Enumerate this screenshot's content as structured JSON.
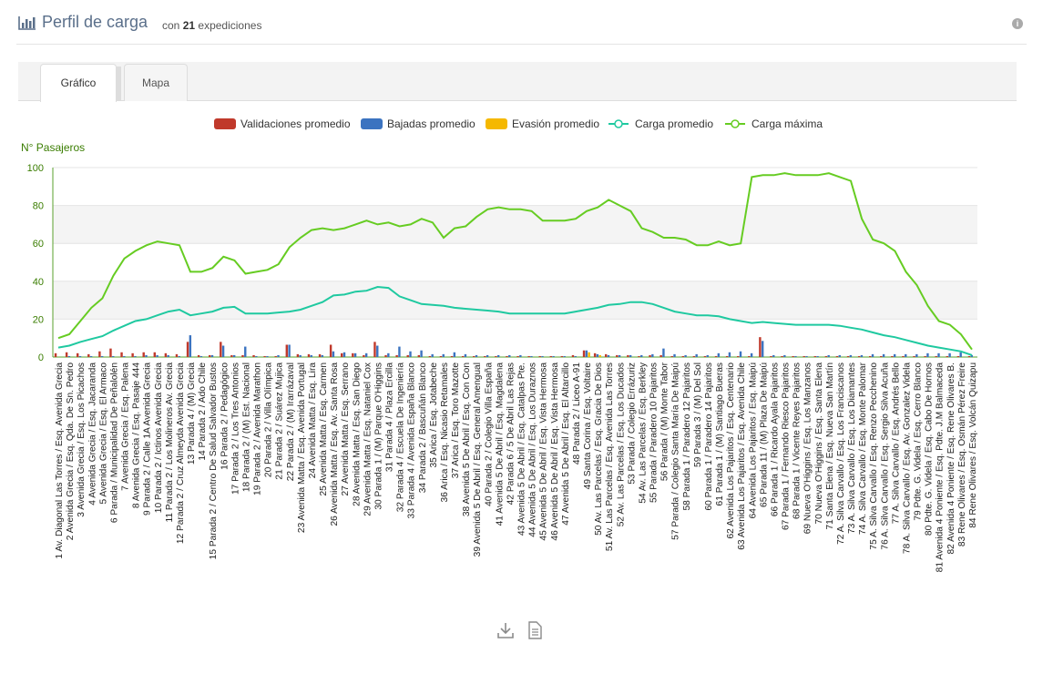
{
  "header": {
    "title": "Perfil de carga",
    "sub_prefix": "con",
    "count": "21",
    "sub_suffix": "expediciones"
  },
  "tabs": [
    {
      "label": "Gráfico"
    },
    {
      "label": "Mapa"
    }
  ],
  "colors": {
    "validaciones": "#c0392b",
    "bajadas": "#3b73c0",
    "evasion": "#f5b800",
    "carga_prom": "#1fc9a0",
    "carga_max": "#66cc22"
  },
  "chart_data": {
    "type": "bar",
    "ylabel": "N° Pasajeros",
    "ylim": [
      0,
      100
    ],
    "yticks": [
      0,
      20,
      40,
      60,
      80,
      100
    ],
    "legend": [
      "Validaciones promedio",
      "Bajadas promedio",
      "Evasión promedio",
      "Carga promedio",
      "Carga máxima"
    ],
    "legend_position": "top-center",
    "categories": [
      "1 Av. Diagonal Las Torres / Esq. Avenida Grecia",
      "2 Avenida Grecia / Esq. Qda. De Sn. Pedro",
      "3 Avenida Grecia / Esq. Los Picachos",
      "4 Avenida Grecia / Esq. Jacaranda",
      "5 Avenida Grecia / Esq. El Armaco",
      "6 Parada / Municipalidad De Peñalolén",
      "7 Avenida Grecia / Esq. Palena",
      "8 Avenida Grecia / Esq. Pasaje 444",
      "9 Parada 2 / Calle 1A Avenida Grecia",
      "10 Parada 2 / Ictinos Avenida Grecia",
      "11 Parada 2 / Los Molineros Av. Grecia",
      "12 Parada 2 / Cruz Almeyda Avenida Grecia",
      "13 Parada 4 / (M) Grecia",
      "14 Parada 2 / Ado Chile",
      "15 Parada 2 / Centro De Salud Salvador Bustos",
      "16 Parada 2 / Pedagógico",
      "17 Parada 2 / Los Tres Antonios",
      "18 Parada 2 / (M) Est. Nacional",
      "19 Parada 2 / Avenida Marathon",
      "20 Parada 2 / Villa Olímpica",
      "21 Parada 2 / Suárez Mujica",
      "22 Parada 2 / (M) Irarrázaval",
      "23 Avenida Matta / Esq. Avenida Portugal",
      "24 Avenida Matta / Esq. Lira",
      "25 Avenida Matta / Esq. Carmen",
      "26 Avenida Matta / Esq. Av. Santa Rosa",
      "27 Avenida Matta / Esq. Serrano",
      "28 Avenida Matta / Esq. San Diego",
      "29 Avenida Matta / Esq. Nataniel Cox",
      "30 Parada 1 / (M) Parque O'Higgins",
      "31 Parada 4 / Plaza Ercilla",
      "32 Parada 4 / Escuela De Ingeniería",
      "33 Parada 4 / Avenida España Blanco",
      "34 Parada 2 / Bascuñán Blanco",
      "35 Arica / Esq. Jotabeche",
      "36 Arica / Esq. Nicasio Retamales",
      "37 Arica / Esq. Toro Mazotte",
      "38 Avenida 5 De Abril / Esq. Con Con",
      "39 Avenida 5 De Abril / Esq. General Amengual",
      "40 Parada 2 / Colegio Villa España",
      "41 Avenida 5 De Abril / Esq. Magdalena",
      "42 Parada 6 / 5 De Abril Las Rejas",
      "43 Avenida 5 De Abril / Esq. Catalpas Pte.",
      "44 Avenida 5 De Abril / Esq. Los Duraznos",
      "45 Avenida 5 De Abril / Esq. Vista Hermosa",
      "46 Avenida 5 De Abril / Esq. Vista Hermosa",
      "47 Avenida 5 De Abril / Esq. El Altarcillo",
      "48 Parada 2 / Liceo A-91",
      "49 Santa Corina / Esq. Voltaire",
      "50 Av. Las Parcelas / Esq. Gracia De Dios",
      "51 Av. Las Parcelas / Esq. Avenida Las Torres",
      "52 Av. Las Parcelas / Esq. Los Ducados",
      "53 Parada / Colegio Errázuriz",
      "54 Av. Las Parcelas / Esq. Berkley",
      "55 Parada / Paradero 10 Pajaritos",
      "56 Parada / (M) Monte Tabor",
      "57 Parada / Colegio Santa María De Maipú",
      "58 Parada 1 / Paradero 12 Pajaritos",
      "59 Parada 3 / (M) Del Sol",
      "60 Parada 1 / Paradero 14 Pajaritos",
      "61 Parada 1 / (M) Santiago Bueras",
      "62 Avenida Los Pajaritos / Esq. Centenario",
      "63 Avenida Los Pajaritos / Esq. Avenida Chile",
      "64 Avenida Los Pajaritos / Esq. Maipú",
      "65 Parada 11 / (M) Plaza De Maipú",
      "66 Parada 1 / Ricardo Ayala Pajaritos",
      "67 Parada 1 / Fernando Riesco Pajaritos",
      "68 Parada 1 / Vicente Reyes Pajaritos",
      "69 Nueva O'Higgins / Esq. Los Manzanos",
      "70 Nueva O'Higgins / Esq. Santa Elena",
      "71 Santa Elena / Esq. Nueva San Martín",
      "72 A. Silva Carvallo / Esq. Los Franciscanos",
      "73 A. Silva Carvallo / Esq. Los Diamantes",
      "74 A. Silva Carvallo / Esq. Monte Palomar",
      "75 A. Silva Carvallo / Esq. Renzo Pecchenino",
      "76 A. Silva Carvallo / Esq. Sergio Silva Acuña",
      "77 A. Silva Carvallo / Esq. Andrés Bello",
      "78 A. Silva Carvallo / Esq. Av. Gonzalez Videla",
      "79 Pdte. G. Videla / Esq. Cerro Blanco",
      "80 Pdte. G. Videla / Esq. Cabo De Hornos",
      "81 Avenida 4 Poniente / Esq. Pdte. J.M Balmaceda",
      "82 Avenida 4 Poniente / Esq. Rene Olivares B.",
      "83 Rene Olivares / Esq. Osmán Pérez Freire",
      "84 Rene Olivares / Esq. Volcán Quizapu"
    ],
    "series": [
      {
        "name": "Validaciones promedio",
        "type": "bar",
        "values": [
          2,
          2.5,
          2,
          1.5,
          3,
          4.5,
          2.5,
          2,
          2.5,
          2.5,
          2,
          1.5,
          8,
          1,
          1,
          8,
          1,
          1,
          1,
          0.5,
          0.5,
          6.5,
          1.5,
          1.5,
          1.5,
          6.5,
          2,
          2,
          1,
          8,
          1,
          1,
          1,
          1,
          0.5,
          0.5,
          0.5,
          0.5,
          0.5,
          0.5,
          0.5,
          0.5,
          0.5,
          0.5,
          0.5,
          0.5,
          0.5,
          1,
          3.5,
          2,
          1.5,
          1,
          1,
          0.5,
          1,
          1,
          0.5,
          0.5,
          0.5,
          0.5,
          0.5,
          0.5,
          0.5,
          0.5,
          10.5,
          0.5,
          0.5,
          0.5,
          0.5,
          0.5,
          0.5,
          0.5,
          0.5,
          0.5,
          0.5,
          0.5,
          0.5,
          0.5,
          0.5,
          0.5,
          0.5,
          0.5,
          0.5,
          0.5
        ]
      },
      {
        "name": "Bajadas promedio",
        "type": "bar",
        "values": [
          0,
          0.5,
          0.5,
          0.5,
          0.5,
          0.5,
          0.5,
          0.5,
          1,
          1,
          1,
          0.5,
          11.5,
          0.5,
          1,
          6,
          1,
          5.5,
          0.5,
          0.5,
          1,
          6.5,
          1,
          1,
          1,
          3,
          2.5,
          2,
          2,
          6,
          2,
          5.5,
          3,
          3.5,
          1.5,
          1.5,
          2.5,
          1.5,
          1,
          1,
          1,
          1,
          1,
          0.5,
          0.5,
          0.5,
          0.5,
          0.5,
          3.5,
          1.5,
          1,
          1,
          1,
          1,
          1.5,
          4.5,
          1.5,
          1,
          1.5,
          1,
          2,
          2.5,
          3,
          2,
          8.5,
          1,
          1,
          0.5,
          0.5,
          0.5,
          1,
          1,
          1,
          1,
          1.5,
          1.5,
          1.5,
          1.5,
          1.5,
          2,
          2,
          2,
          2.5,
          1
        ]
      },
      {
        "name": "Evasión promedio",
        "type": "bar",
        "values": [
          0,
          0,
          0,
          0,
          0,
          0,
          0,
          0,
          0,
          0,
          0,
          0,
          0,
          0,
          0,
          0,
          0,
          0,
          0,
          0,
          0,
          0,
          0,
          0,
          0,
          0,
          0,
          0,
          0,
          0,
          0,
          0,
          0,
          0,
          0,
          0,
          0,
          0,
          0,
          0,
          0,
          0,
          0,
          0,
          0,
          0,
          0,
          0,
          2.5,
          1,
          0,
          0,
          0,
          0,
          0,
          0,
          0,
          0,
          0,
          0,
          0,
          0,
          0,
          0,
          0,
          0,
          0,
          0,
          0,
          0,
          0,
          0,
          0,
          0,
          0,
          0,
          0,
          0,
          0,
          0,
          0,
          0,
          0,
          0
        ]
      },
      {
        "name": "Carga promedio",
        "type": "line",
        "values": [
          5,
          6,
          8,
          9.5,
          11,
          14,
          16.5,
          19,
          20,
          22,
          24,
          25,
          22,
          23,
          24,
          26,
          26.5,
          23,
          23,
          23,
          23.5,
          24,
          25,
          27,
          29,
          32.5,
          33,
          34.5,
          35,
          37,
          36.5,
          32,
          30,
          28,
          27.5,
          27,
          26,
          25.5,
          25,
          24.5,
          24,
          23,
          23,
          23,
          23,
          23,
          23,
          24,
          25,
          26,
          27.5,
          28,
          29,
          29,
          28,
          26,
          24,
          23,
          22,
          22,
          21.5,
          20,
          19,
          18,
          18.5,
          18,
          17.5,
          17,
          17,
          17,
          17,
          16.5,
          15.5,
          14.5,
          13,
          11.5,
          10.5,
          9,
          7.5,
          6,
          5,
          4,
          3,
          1
        ]
      },
      {
        "name": "Carga máxima",
        "type": "line",
        "values": [
          10,
          12,
          19,
          26,
          31,
          43,
          52,
          56,
          59,
          61,
          60,
          59,
          45,
          45,
          47,
          53,
          51,
          44,
          45,
          46,
          49,
          58,
          63,
          67,
          68,
          67,
          68,
          70,
          72,
          70,
          71,
          69,
          70,
          73,
          71,
          63,
          68,
          69,
          74,
          78,
          79,
          78,
          78,
          77,
          72,
          72,
          72,
          73,
          77,
          79,
          83,
          80,
          77,
          68,
          66,
          63,
          63,
          62,
          59,
          59,
          61,
          59,
          60,
          95,
          96,
          96,
          97,
          96,
          96,
          96,
          97,
          95,
          93,
          73,
          62,
          60,
          56,
          45,
          38,
          27,
          19,
          17,
          12,
          4
        ]
      }
    ]
  }
}
